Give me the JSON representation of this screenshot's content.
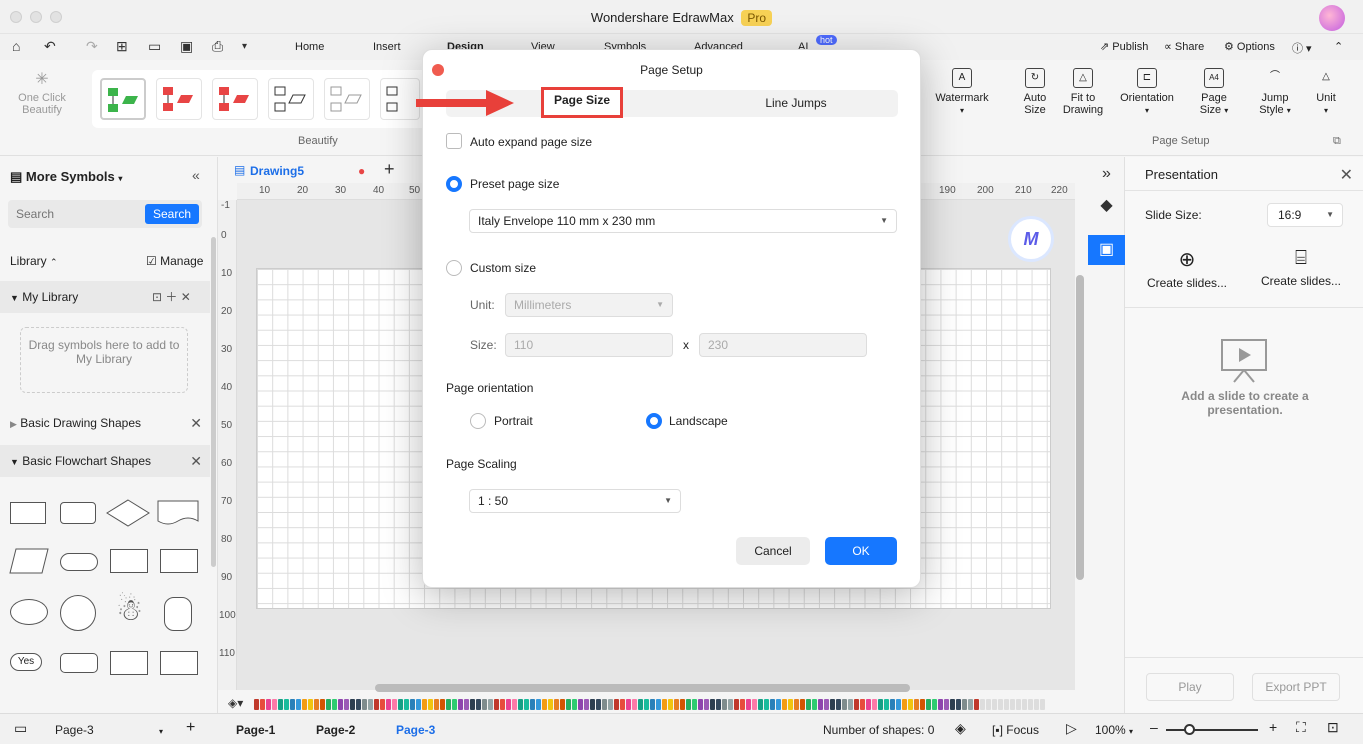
{
  "app": {
    "title": "Wondershare EdrawMax",
    "badge": "Pro"
  },
  "menu": {
    "items": [
      "Home",
      "Insert",
      "Design",
      "View",
      "Symbols",
      "Advanced",
      "AI"
    ],
    "active": "Design",
    "ai_badge": "hot",
    "right": {
      "publish": "Publish",
      "share": "Share",
      "options": "Options"
    }
  },
  "ribbon": {
    "one_click": "One Click",
    "beautify_sub": "Beautify",
    "beautify_group": "Beautify",
    "page_setup_group": "Page Setup",
    "buttons": {
      "watermark": "Watermark",
      "auto_size_1": "Auto",
      "auto_size_2": "Size",
      "fit_1": "Fit to",
      "fit_2": "Drawing",
      "orientation": "Orientation",
      "page_size_1": "Page",
      "page_size_2": "Size",
      "jump_1": "Jump",
      "jump_2": "Style",
      "unit": "Unit"
    }
  },
  "left_panel": {
    "header": "More Symbols",
    "search_placeholder": "Search",
    "search_button": "Search",
    "library_label": "Library",
    "manage_label": "Manage",
    "my_library": "My Library",
    "drag_hint": "Drag symbols here to add to My Library",
    "basic_drawing": "Basic Drawing Shapes",
    "basic_flowchart": "Basic Flowchart Shapes",
    "yes_label": "Yes"
  },
  "document": {
    "tab_name": "Drawing5",
    "ruler_h": [
      "10",
      "20",
      "30",
      "40",
      "50",
      "190",
      "200",
      "210",
      "220"
    ],
    "ruler_v": [
      "-1",
      "0",
      "10",
      "20",
      "30",
      "40",
      "50",
      "60",
      "70",
      "80",
      "90",
      "100",
      "110"
    ]
  },
  "dialog": {
    "title": "Page Setup",
    "tabs": {
      "page_size": "Page Size",
      "line_jumps": "Line Jumps"
    },
    "auto_expand": "Auto expand page size",
    "preset_label": "Preset page size",
    "preset_value": "Italy Envelope 110 mm x 230 mm",
    "custom_label": "Custom size",
    "unit_label": "Unit:",
    "unit_value": "Millimeters",
    "size_label": "Size:",
    "width": "110",
    "times": "x",
    "height": "230",
    "orientation_label": "Page orientation",
    "portrait": "Portrait",
    "landscape": "Landscape",
    "scaling_label": "Page Scaling",
    "scaling_value": "1 : 50",
    "cancel": "Cancel",
    "ok": "OK"
  },
  "right_panel": {
    "title": "Presentation",
    "slide_size_label": "Slide Size:",
    "slide_size_value": "16:9",
    "create_slides_1": "Create slides...",
    "create_slides_2": "Create slides...",
    "empty_text": "Add a slide to create a presentation.",
    "play": "Play",
    "export": "Export PPT"
  },
  "status": {
    "current_page": "Page-3",
    "pages": [
      "Page-1",
      "Page-2",
      "Page-3"
    ],
    "shapes": "Number of shapes: 0",
    "focus": "Focus",
    "zoom": "100%"
  },
  "colors": {
    "accent": "#1677ff",
    "highlight": "#e8403a"
  }
}
